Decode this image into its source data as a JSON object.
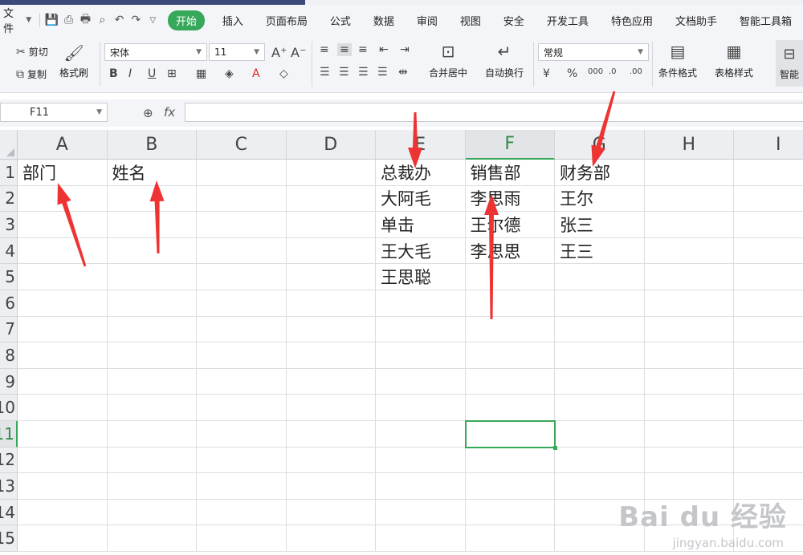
{
  "menu": {
    "file": "文件",
    "items": [
      "开始",
      "插入",
      "页面布局",
      "公式",
      "数据",
      "审阅",
      "视图",
      "安全",
      "开发工具",
      "特色应用",
      "文档助手",
      "智能工具箱"
    ],
    "active_index": 0,
    "accent": "#36a85a"
  },
  "ribbon": {
    "cut": "剪切",
    "copy": "复制",
    "format_painter": "格式刷",
    "font_name": "宋体",
    "font_size": "11",
    "merge_center": "合并居中",
    "wrap_text": "自动换行",
    "number_format": "常规",
    "conditional_format": "条件格式",
    "table_style": "表格样式",
    "smart": "智能"
  },
  "formula_bar": {
    "name_box": "F11",
    "fx": "fx",
    "content": ""
  },
  "grid": {
    "columns": [
      "A",
      "B",
      "C",
      "D",
      "E",
      "F",
      "G",
      "H",
      "I"
    ],
    "selected_column": "F",
    "rows": [
      "1",
      "2",
      "3",
      "4",
      "5",
      "6",
      "7",
      "8",
      "9",
      "10",
      "11",
      "12",
      "13",
      "14",
      "15"
    ],
    "selected_row": "11",
    "cells": {
      "A1": "部门",
      "B1": "姓名",
      "E1": "总裁办",
      "E2": "大阿毛",
      "E3": "单击",
      "E4": "王大毛",
      "E5": "王思聪",
      "F1": "销售部",
      "F2": "李思雨",
      "F3": "王尔德",
      "F4": "李思思",
      "G1": "财务部",
      "G2": "王尔",
      "G3": "张三",
      "G4": "王三"
    },
    "active_cell": "F11"
  },
  "annotations": {
    "arrow_color": "#ee3333"
  },
  "watermark": {
    "brand": "Bai du 经验",
    "url": "jingyan.baidu.com"
  }
}
